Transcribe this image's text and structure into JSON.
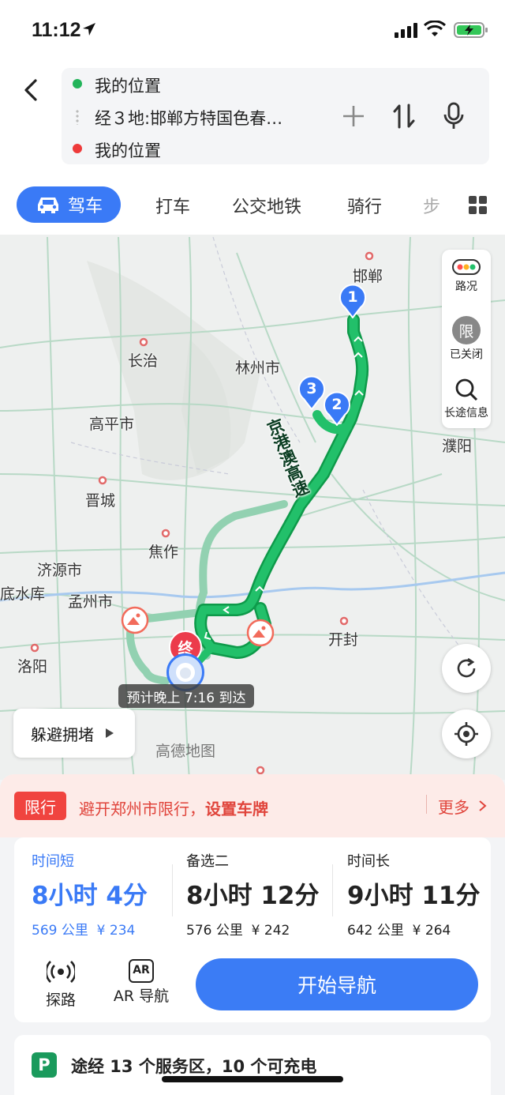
{
  "status_bar": {
    "time": "11:12"
  },
  "route": {
    "origin": "我的位置",
    "waypoint": "经３地:邯郸方特国色春…",
    "destination": "我的位置"
  },
  "tabs": {
    "active": "驾车",
    "items": [
      "打车",
      "公交地铁",
      "骑行",
      "步"
    ]
  },
  "map": {
    "labels": {
      "handan": "邯郸",
      "changzhi": "长治",
      "linzhou": "林州市",
      "gaoping": "高平市",
      "puyang": "濮阳",
      "jincheng": "晋城",
      "jiaozuo": "焦作",
      "jiyuan": "济源市",
      "mengzhou": "孟州市",
      "dishuiku": "底水库",
      "luoyang": "洛阳",
      "kaifeng": "开封",
      "highway": "京港澳高速"
    },
    "markers": {
      "m1": "1",
      "m2": "2",
      "m3": "3",
      "end": "终"
    },
    "controls": {
      "traffic": "路况",
      "limit_icon": "限",
      "limit": "已关闭",
      "long_trip": "长途信息"
    },
    "avoid_congestion": "躲避拥堵",
    "eta": "预计晚上 7:16 到达",
    "watermark": "高德地图"
  },
  "restriction": {
    "badge": "限行",
    "text": "避开郑州市限行，",
    "link": "设置车牌",
    "more": "更多"
  },
  "routes": [
    {
      "tag": "时间短",
      "duration": "8小时 4分",
      "distance": "569 公里",
      "toll": "¥ 234"
    },
    {
      "tag": "备选二",
      "duration": "8小时 12分",
      "distance": "576 公里",
      "toll": "¥ 242"
    },
    {
      "tag": "时间长",
      "duration": "9小时 11分",
      "distance": "642 公里",
      "toll": "¥ 264"
    }
  ],
  "tools": {
    "explore": "探路",
    "ar_icon": "AR",
    "ar": "AR 导航"
  },
  "start_nav": "开始导航",
  "service": {
    "icon": "P",
    "text": "途经 13 个服务区，10 个可充电"
  },
  "colors": {
    "accent": "#3a7af6",
    "route_green": "#1db35d",
    "alt_green": "#8fcfb0",
    "limit_red": "#f0443f"
  }
}
